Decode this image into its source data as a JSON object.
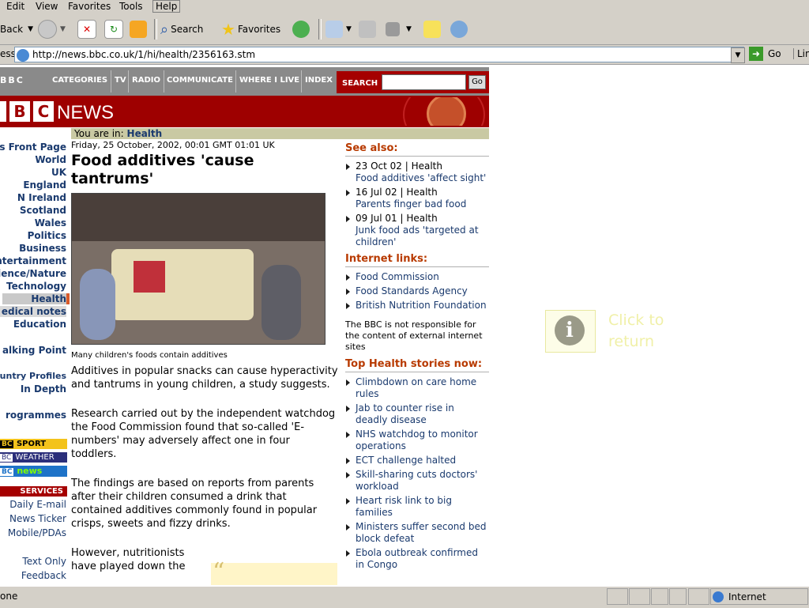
{
  "menu": [
    "Edit",
    "View",
    "Favorites",
    "Tools",
    "Help"
  ],
  "toolbar": {
    "back": "Back",
    "search": "Search",
    "favorites": "Favorites"
  },
  "address": {
    "label": "ess",
    "url": "http://news.bbc.co.uk/1/hi/health/2356163.stm",
    "go": "Go",
    "links": "Lin"
  },
  "bbc": {
    "logo_small": "BBC",
    "nav": [
      "CATEGORIES",
      "TV",
      "RADIO",
      "COMMUNICATE",
      "WHERE I LIVE",
      "INDEX"
    ],
    "search_label": "SEARCH",
    "search_go": "Go",
    "news_title": "NEWS",
    "you_are_in": "You are in:",
    "section": "Health"
  },
  "left_nav": [
    "ws Front Page",
    "World",
    "UK",
    "England",
    "N Ireland",
    "Scotland",
    "Wales",
    "Politics",
    "Business",
    "ntertainment",
    "ience/Nature",
    "Technology",
    "Health",
    "edical notes",
    "Education",
    "alking Point",
    "untry Profiles",
    "In Depth",
    "rogrammes"
  ],
  "left_badges": [
    "SPORT",
    "WEATHER",
    "news"
  ],
  "services": {
    "title": "SERVICES",
    "items": [
      "Daily E-mail",
      "News Ticker",
      "Mobile/PDAs"
    ],
    "bottom": [
      "Text Only",
      "Feedback"
    ]
  },
  "article": {
    "date": "Friday, 25 October, 2002, 00:01 GMT 01:01 UK",
    "headline": "Food additives 'cause tantrums'",
    "caption": "Many children's foods contain additives",
    "p1": "Additives in popular snacks can cause hyperactivity and tantrums in young children, a study suggests.",
    "p2": "Research carried out by the independent watchdog the Food Commission found that so-called 'E-numbers' may adversely affect one in four toddlers.",
    "p3": "The findings are based on reports from parents after their children consumed a drink that contained additives commonly found in popular crisps, sweets and fizzy drinks.",
    "p4": "However, nutritionists have played down the"
  },
  "see_also": {
    "title": "See also:",
    "items": [
      {
        "date": "23 Oct 02 | Health",
        "link": "Food additives 'affect sight'"
      },
      {
        "date": "16 Jul 02 | Health",
        "link": "Parents finger bad food"
      },
      {
        "date": "09 Jul 01 | Health",
        "link": "Junk food ads 'targeted at children'"
      }
    ]
  },
  "internet_links": {
    "title": "Internet links:",
    "items": [
      "Food Commission",
      "Food Standards Agency",
      "British Nutrition Foundation"
    ],
    "disclaimer": "The BBC is not responsible for the content of external internet sites"
  },
  "top_stories": {
    "title": "Top Health stories now:",
    "items": [
      "Climbdown on care home rules",
      "Jab to counter rise in deadly disease",
      "NHS watchdog to monitor operations",
      "ECT challenge halted",
      "Skill-sharing cuts doctors' workload",
      "Heart risk link to big families",
      "Ministers suffer second bed block defeat",
      "Ebola outbreak confirmed in Congo"
    ]
  },
  "overlay": {
    "text": "Click to return"
  },
  "status": {
    "left": "one",
    "zone": "Internet"
  }
}
